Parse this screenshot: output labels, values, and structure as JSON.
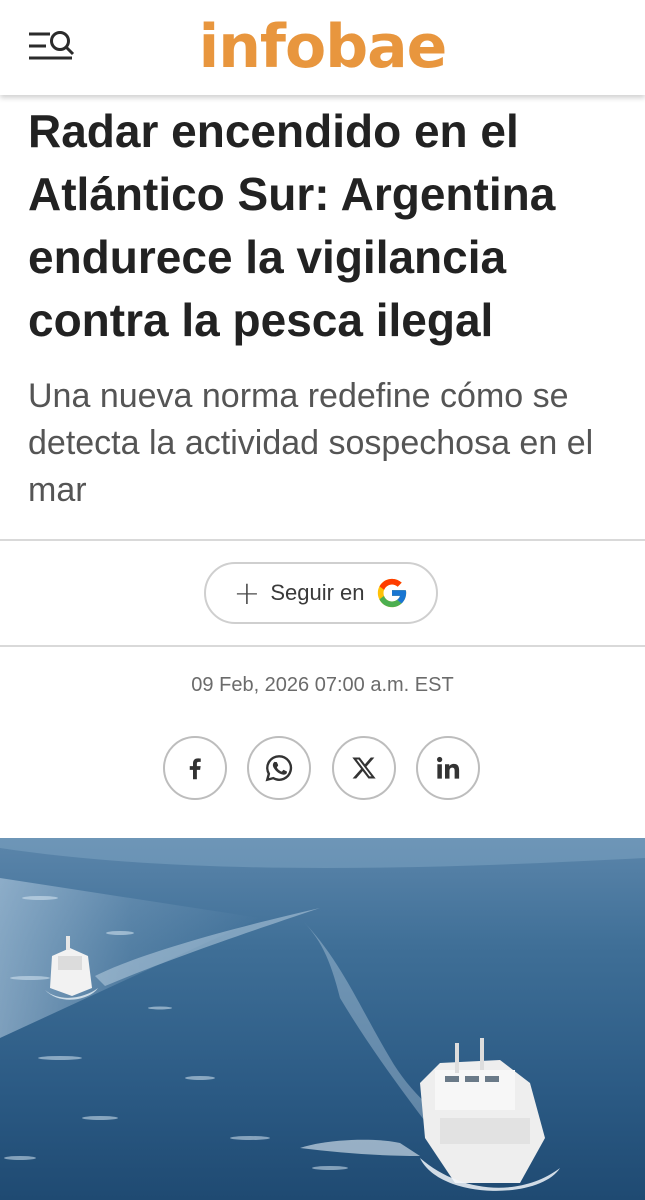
{
  "header": {
    "logo_text": "infobae",
    "menu_icon": "menu-search-icon",
    "brand_color": "#e8963e"
  },
  "article": {
    "headline": "Radar encendido en el Atlántico Sur: Argentina endurece la vigilancia contra la pesca ilegal",
    "subtitle": "Una nueva norma redefine cómo se detecta la actividad sospechosa en el mar",
    "date": "09 Feb, 2026 07:00 a.m. EST"
  },
  "follow": {
    "plus_symbol": "+",
    "label": "Seguir en",
    "icon": "google-g-icon"
  },
  "share": [
    {
      "name": "facebook",
      "icon": "facebook-icon"
    },
    {
      "name": "whatsapp",
      "icon": "whatsapp-icon"
    },
    {
      "name": "x",
      "icon": "x-icon"
    },
    {
      "name": "linkedin",
      "icon": "linkedin-icon"
    }
  ]
}
